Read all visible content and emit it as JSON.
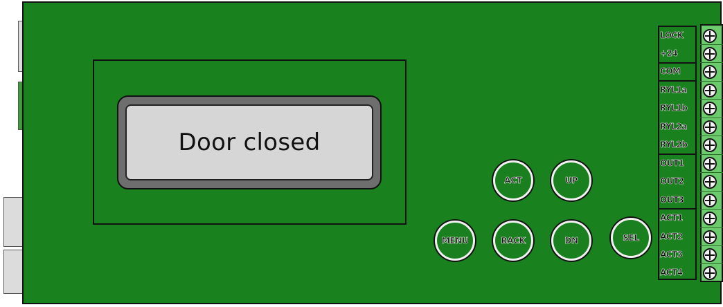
{
  "lcd": {
    "text": "Door closed"
  },
  "buttons": {
    "act": "ACT",
    "up": "UP",
    "menu": "MENU",
    "back": "BACK",
    "dn": "DN",
    "sel": "SEL"
  },
  "terminals": [
    "LOCK",
    "+24",
    "COM",
    "RYL1a",
    "RYL1b",
    "RYL2a",
    "RYL2b",
    "OUT1",
    "OUT2",
    "OUT3",
    "ACT1",
    "ACT2",
    "ACT3",
    "ACT4"
  ],
  "colors": {
    "board": "#19811e",
    "terminal_block": "#6ccb6c",
    "lcd_screen": "#d6d6d6",
    "lcd_bezel": "#6e6e6e"
  }
}
